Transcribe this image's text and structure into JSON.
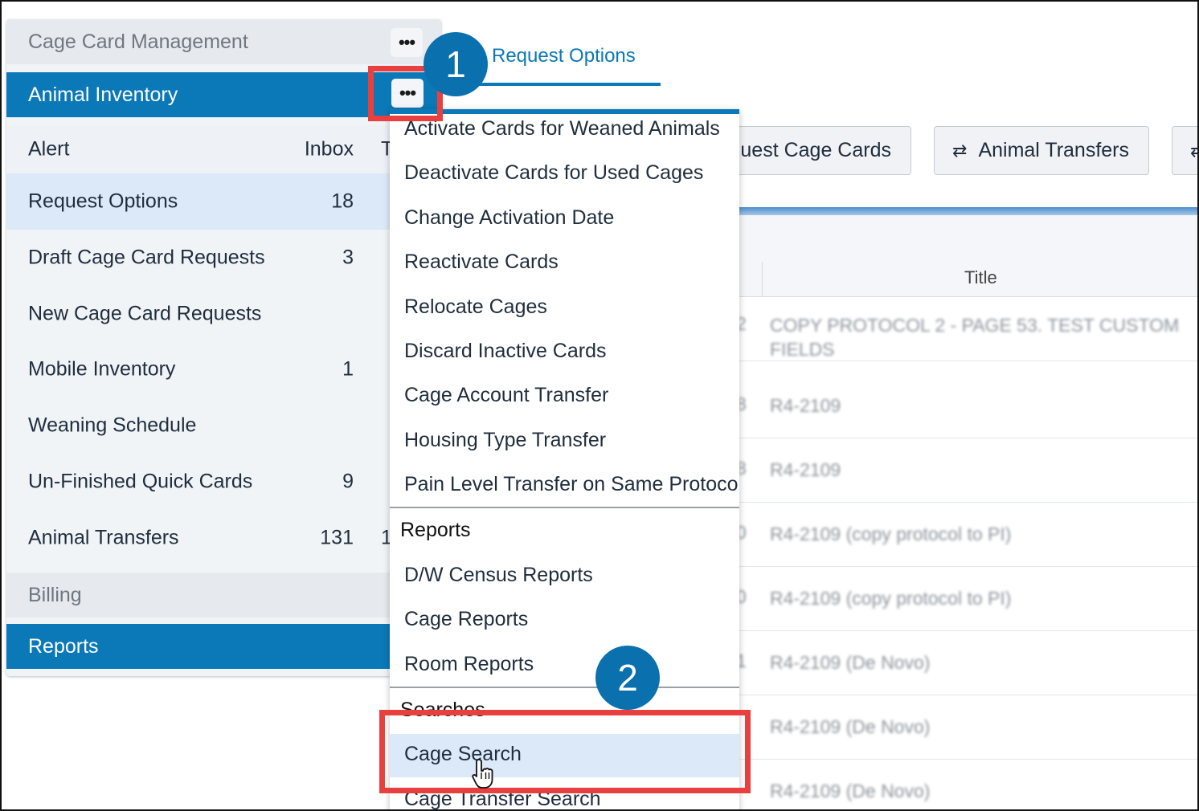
{
  "sidebar": {
    "cage_card_management": "Cage Card Management",
    "animal_inventory": "Animal Inventory",
    "more_label": "•••",
    "columns": {
      "alert": "Alert",
      "inbox": "Inbox",
      "total_partial": "To"
    },
    "rows": [
      {
        "label": "Request Options",
        "inbox": "18",
        "extra": ""
      },
      {
        "label": "Draft Cage Card Requests",
        "inbox": "3",
        "extra": ""
      },
      {
        "label": "New Cage Card Requests",
        "inbox": "",
        "extra": ""
      },
      {
        "label": "Mobile Inventory",
        "inbox": "1",
        "extra": ""
      },
      {
        "label": "Weaning Schedule",
        "inbox": "",
        "extra": ""
      },
      {
        "label": "Un-Finished Quick Cards",
        "inbox": "9",
        "extra": ""
      },
      {
        "label": "Animal Transfers",
        "inbox": "131",
        "extra": "1"
      }
    ],
    "billing": "Billing",
    "reports": "Reports"
  },
  "main": {
    "active_tab": "Request Options",
    "buttons": [
      {
        "label": "quest Cage Cards",
        "icon": ""
      },
      {
        "label": "Animal Transfers",
        "icon": "⇄"
      },
      {
        "label": "",
        "icon": "⇄"
      }
    ],
    "table": {
      "title_header": "Title",
      "rows": [
        {
          "num": "2",
          "title": "COPY PROTOCOL 2 - PAGE 53. TEST CUSTOM FIELDS"
        },
        {
          "num": "8",
          "title": "R4-2109"
        },
        {
          "num": "8",
          "title": "R4-2109"
        },
        {
          "num": "0",
          "title": "R4-2109 (copy protocol to PI)"
        },
        {
          "num": "0",
          "title": "R4-2109 (copy protocol to PI)"
        },
        {
          "num": "1",
          "title": "R4-2109 (De Novo)"
        },
        {
          "num": "",
          "title": "R4-2109 (De Novo)"
        },
        {
          "num": "",
          "title": "R4-2109 (De Novo)"
        }
      ]
    }
  },
  "menu": {
    "items": [
      "Activate Cards for Weaned Animals",
      "Deactivate Cards for Used Cages",
      "Change Activation Date",
      "Reactivate Cards",
      "Relocate Cages",
      "Discard Inactive Cards",
      "Cage Account Transfer",
      "Housing Type Transfer",
      "Pain Level Transfer on Same Protocol"
    ],
    "reports_group": "Reports",
    "reports_items": [
      "D/W Census Reports",
      "Cage Reports",
      "Room Reports"
    ],
    "searches_group": "Searches",
    "searches_items": [
      "Cage Search",
      "Cage Transfer Search"
    ]
  },
  "callouts": {
    "one": "1",
    "two": "2"
  },
  "colors": {
    "brand_blue": "#0b78b7",
    "highlight_red": "#e8403e",
    "selected_row": "#dbe9f9"
  }
}
